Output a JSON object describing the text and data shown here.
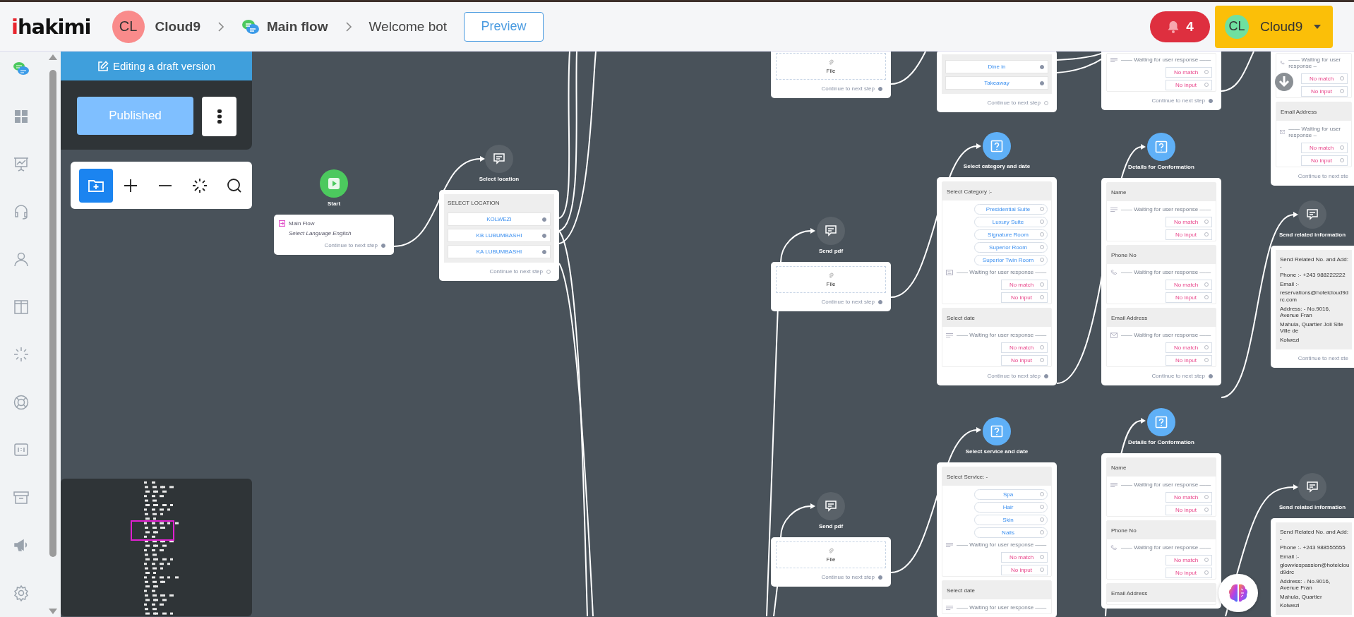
{
  "header": {
    "logo": "ihakimi",
    "workspace": {
      "initials": "CL",
      "name": "Cloud9"
    },
    "flow": "Main flow",
    "page": "Welcome bot",
    "preview": "Preview",
    "notifications": {
      "count": "4"
    },
    "account": {
      "initials": "CL",
      "name": "Cloud9"
    }
  },
  "sidebar": {
    "items": [
      {
        "kind": "chat",
        "selected": true
      },
      {
        "kind": "dashboard",
        "selected": false
      },
      {
        "kind": "analytics",
        "selected": false
      },
      {
        "kind": "support",
        "selected": false
      },
      {
        "kind": "user",
        "selected": false
      },
      {
        "kind": "layout",
        "selected": false
      },
      {
        "kind": "sparkle",
        "selected": false
      },
      {
        "kind": "help",
        "selected": false
      },
      {
        "kind": "counter",
        "selected": false
      },
      {
        "kind": "archive",
        "selected": false
      },
      {
        "kind": "campaign",
        "selected": false
      },
      {
        "kind": "settings",
        "selected": false
      }
    ]
  },
  "draft_panel": {
    "banner": "Editing a draft version",
    "publish_button": "Published"
  },
  "toolbar": {
    "tools": [
      {
        "kind": "add-folder",
        "selected": true
      },
      {
        "kind": "zoom-in",
        "selected": false
      },
      {
        "kind": "zoom-out",
        "selected": false
      },
      {
        "kind": "auto-layout",
        "selected": false
      },
      {
        "kind": "search",
        "selected": false
      }
    ]
  },
  "nodes": [
    {
      "kind": "start",
      "label": "Start",
      "blocks": [
        {
          "kind": "entry",
          "title": "Main Flow",
          "subtitle": "Select Language English"
        }
      ],
      "continue": {
        "text": "Continue to next step",
        "connected": true
      }
    },
    {
      "kind": "message",
      "label": "Select location",
      "blocks": [
        {
          "kind": "menu",
          "heading": "SELECT LOCATION",
          "options": [
            {
              "text": "KOLWEZI",
              "connected": true
            },
            {
              "text": "KB LUBUMBASHI",
              "connected": true
            },
            {
              "text": "KA LUBUMBASHI",
              "connected": true
            }
          ]
        }
      ],
      "continue": {
        "text": "Continue to next step",
        "connected": false
      }
    },
    {
      "blocks": [
        {
          "kind": "file",
          "text": "File"
        }
      ],
      "continue": {
        "text": "Continue to next step",
        "connected": true
      }
    },
    {
      "kind": "message",
      "label": "Send pdf",
      "blocks": [
        {
          "kind": "file",
          "text": "File"
        }
      ],
      "continue": {
        "text": "Continue to next step",
        "connected": true
      }
    },
    {
      "kind": "message",
      "label": "Send pdf",
      "blocks": [
        {
          "kind": "file",
          "text": "File"
        }
      ],
      "continue": {
        "text": "Continue to next step",
        "connected": true
      }
    },
    {
      "blocks": [
        {
          "kind": "menu",
          "options": [
            {
              "text": "Dine in",
              "connected": true
            },
            {
              "text": "Takeaway",
              "connected": true
            }
          ]
        }
      ],
      "continue": {
        "text": "Continue to next step",
        "connected": false
      }
    },
    {
      "kind": "question",
      "label": "Select category and date",
      "blocks": [
        {
          "kind": "choice-input",
          "heading": "Select Category :-",
          "options": [
            {
              "text": "Presidential Suite",
              "connected": false
            },
            {
              "text": "Luxury Suite",
              "connected": false
            },
            {
              "text": "Signature Room",
              "connected": false
            },
            {
              "text": "Superior Room",
              "connected": false
            },
            {
              "text": "Superior Twin Room",
              "connected": false
            }
          ],
          "waiting": "—— Waiting for user response ——",
          "fallbacks": [
            {
              "text": "No match",
              "connected": false
            },
            {
              "text": "No input",
              "connected": false
            }
          ]
        },
        {
          "kind": "text-input",
          "heading": "Select date",
          "waiting": "—— Waiting for user response ——",
          "fallbacks": [
            {
              "text": "No match",
              "connected": false
            },
            {
              "text": "No input",
              "connected": false
            }
          ]
        }
      ],
      "continue": {
        "text": "Continue to next step",
        "connected": true
      }
    },
    {
      "kind": "question",
      "label": "Select service and date",
      "blocks": [
        {
          "kind": "text-input",
          "heading": "Select Service: -",
          "options": [
            {
              "text": "Spa",
              "connected": false
            },
            {
              "text": "Hair",
              "connected": false
            },
            {
              "text": "Skin",
              "connected": false
            },
            {
              "text": "Nails",
              "connected": false
            }
          ],
          "waiting": "—— Waiting for user response ——",
          "fallbacks": [
            {
              "text": "No match",
              "connected": false
            },
            {
              "text": "No input",
              "connected": false
            }
          ]
        },
        {
          "kind": "text-input",
          "heading": "Select date",
          "waiting": "—— Waiting for user response ——"
        }
      ]
    },
    {
      "blocks": [
        {
          "kind": "text-input",
          "waiting": "—— Waiting for user response ——",
          "fallbacks": [
            {
              "text": "No match",
              "connected": false
            },
            {
              "text": "No input",
              "connected": false
            }
          ]
        }
      ],
      "continue": {
        "text": "Continue to next step",
        "connected": true
      }
    },
    {
      "kind": "question",
      "label": "Details for Conformation",
      "blocks": [
        {
          "kind": "text-input",
          "heading": "Name",
          "waiting": "—— Waiting for user response ——",
          "fallbacks": [
            {
              "text": "No match",
              "connected": false
            },
            {
              "text": "No input",
              "connected": false
            }
          ]
        },
        {
          "kind": "phone-input",
          "heading": "Phone No",
          "waiting": "—— Waiting for user response ——",
          "fallbacks": [
            {
              "text": "No match",
              "connected": false
            },
            {
              "text": "No input",
              "connected": false
            }
          ]
        },
        {
          "kind": "email-input",
          "heading": "Email Address",
          "waiting": "—— Waiting for user response ——",
          "fallbacks": [
            {
              "text": "No match",
              "connected": false
            },
            {
              "text": "No input",
              "connected": false
            }
          ]
        }
      ],
      "continue": {
        "text": "Continue to next step",
        "connected": true
      }
    },
    {
      "kind": "question",
      "label": "Details for Conformation",
      "blocks": [
        {
          "kind": "text-input",
          "heading": "Name",
          "waiting": "—— Waiting for user response ——",
          "fallbacks": [
            {
              "text": "No match",
              "connected": false
            },
            {
              "text": "No input",
              "connected": false
            }
          ]
        },
        {
          "kind": "phone-input",
          "heading": "Phone No",
          "waiting": "—— Waiting for user response ——",
          "fallbacks": [
            {
              "text": "No match",
              "connected": false
            },
            {
              "text": "No input",
              "connected": false
            }
          ]
        },
        {
          "kind": "email-input",
          "heading": "Email Address"
        }
      ]
    },
    {
      "blocks": [
        {
          "kind": "phone-input",
          "waiting": "—— Waiting for user response –",
          "fallbacks": [
            {
              "text": "No match",
              "connected": false
            },
            {
              "text": "No input",
              "connected": false
            }
          ]
        },
        {
          "kind": "email-input",
          "heading": "Email Address",
          "waiting": "—— Waiting for user response –",
          "fallbacks": [
            {
              "text": "No match",
              "connected": false
            },
            {
              "text": "No input",
              "connected": false
            }
          ]
        }
      ],
      "continue": {
        "text": "Continue to next ste"
      }
    },
    {
      "kind": "message",
      "label": "Send related information",
      "blocks": [
        {
          "kind": "text",
          "lines": [
            "Send Related No. and Add: -",
            "Phone :- +243 988222222",
            "Email :-",
            "reservations@hotelcloud9drc.com",
            "Address: - No.9016, Avenue Fran",
            "Mahula, Quartier Joli Site Ville de",
            "Kolwezi"
          ]
        }
      ],
      "continue": {
        "text": "Continue to next ste"
      }
    },
    {
      "kind": "message",
      "label": "Send related information",
      "blocks": [
        {
          "kind": "text",
          "lines": [
            "Send Related No. and Add: -",
            "Phone :- +243 988555555",
            "Email :-",
            "glowviespassion@hotelcloud9drc",
            "Address: - No.9016, Avenue Fran",
            "Mahula, Quartier",
            "Kolwezi"
          ]
        }
      ]
    }
  ]
}
